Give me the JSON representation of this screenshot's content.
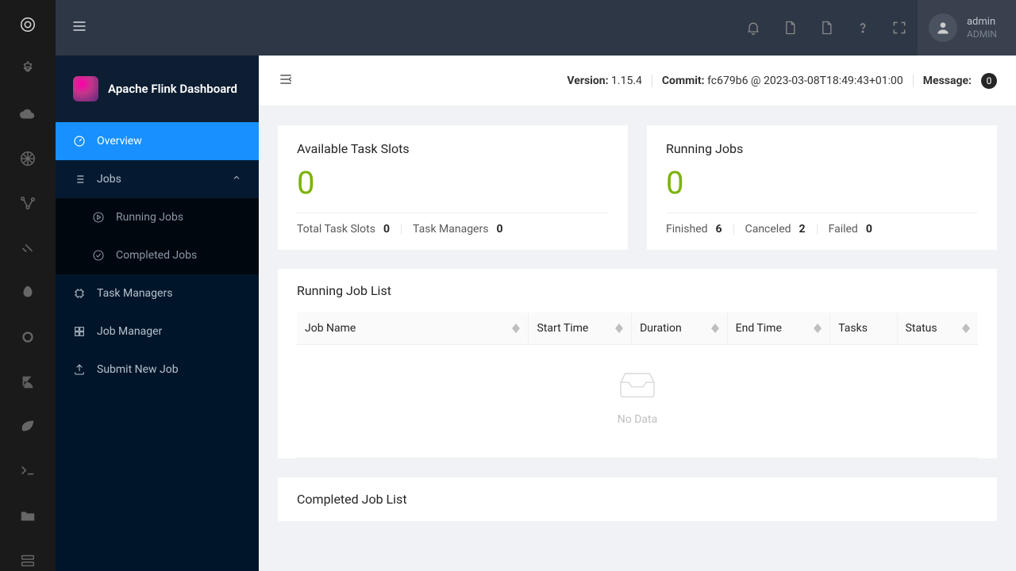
{
  "user": {
    "name": "admin",
    "role": "ADMIN"
  },
  "sidebar": {
    "title": "Apache Flink Dashboard",
    "overview": "Overview",
    "jobs": "Jobs",
    "runningJobs": "Running Jobs",
    "completedJobs": "Completed Jobs",
    "taskManagers": "Task Managers",
    "jobManager": "Job Manager",
    "submitNewJob": "Submit New Job"
  },
  "pagebar": {
    "versionLabel": "Version:",
    "version": "1.15.4",
    "commitLabel": "Commit:",
    "commit": "fc679b6 @ 2023-03-08T18:49:43+01:00",
    "messageLabel": "Message:",
    "messageCount": "0"
  },
  "cards": {
    "slots": {
      "title": "Available Task Slots",
      "value": "0",
      "totalSlotsLabel": "Total Task Slots",
      "totalSlotsValue": "0",
      "taskManagersLabel": "Task Managers",
      "taskManagersValue": "0"
    },
    "jobs": {
      "title": "Running Jobs",
      "value": "0",
      "finishedLabel": "Finished",
      "finishedValue": "6",
      "canceledLabel": "Canceled",
      "canceledValue": "2",
      "failedLabel": "Failed",
      "failedValue": "0"
    }
  },
  "table": {
    "runningTitle": "Running Job List",
    "completedTitle": "Completed Job List",
    "columns": {
      "jobName": "Job Name",
      "startTime": "Start Time",
      "duration": "Duration",
      "endTime": "End Time",
      "tasks": "Tasks",
      "status": "Status"
    },
    "noData": "No Data"
  }
}
